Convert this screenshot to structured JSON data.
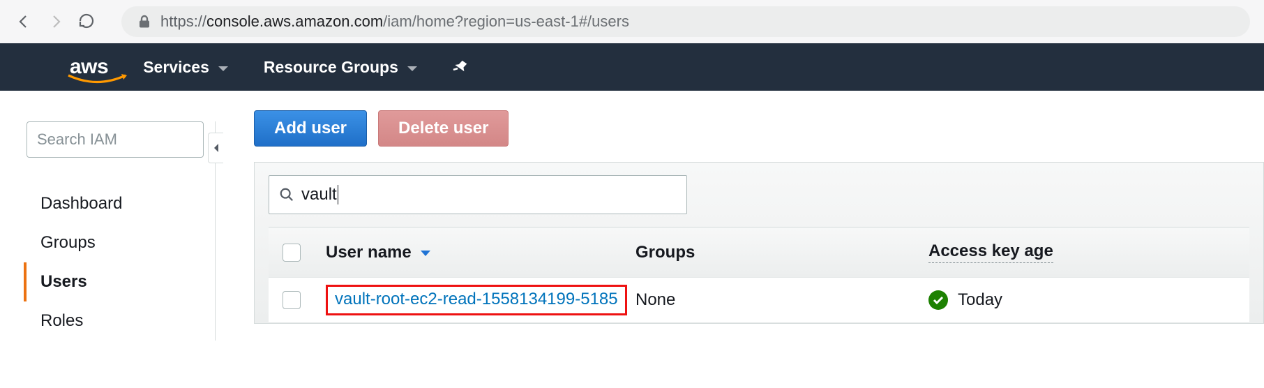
{
  "browser": {
    "url_scheme": "https://",
    "url_host": "console.aws.amazon.com",
    "url_rest": "/iam/home?region=us-east-1#/users"
  },
  "topnav": {
    "logo": "aws",
    "services": "Services",
    "resource_groups": "Resource Groups"
  },
  "sidebar": {
    "search_placeholder": "Search IAM",
    "items": [
      {
        "label": "Dashboard"
      },
      {
        "label": "Groups"
      },
      {
        "label": "Users"
      },
      {
        "label": "Roles"
      }
    ],
    "active_index": 2
  },
  "buttons": {
    "add_user": "Add user",
    "delete_user": "Delete user"
  },
  "filter": {
    "value": "vault"
  },
  "table": {
    "columns": {
      "username": "User name",
      "groups": "Groups",
      "access_key_age": "Access key age"
    },
    "rows": [
      {
        "username": "vault-root-ec2-read-1558134199-5185",
        "groups": "None",
        "access_key_age": "Today",
        "highlighted": true,
        "key_status": "ok"
      }
    ]
  }
}
